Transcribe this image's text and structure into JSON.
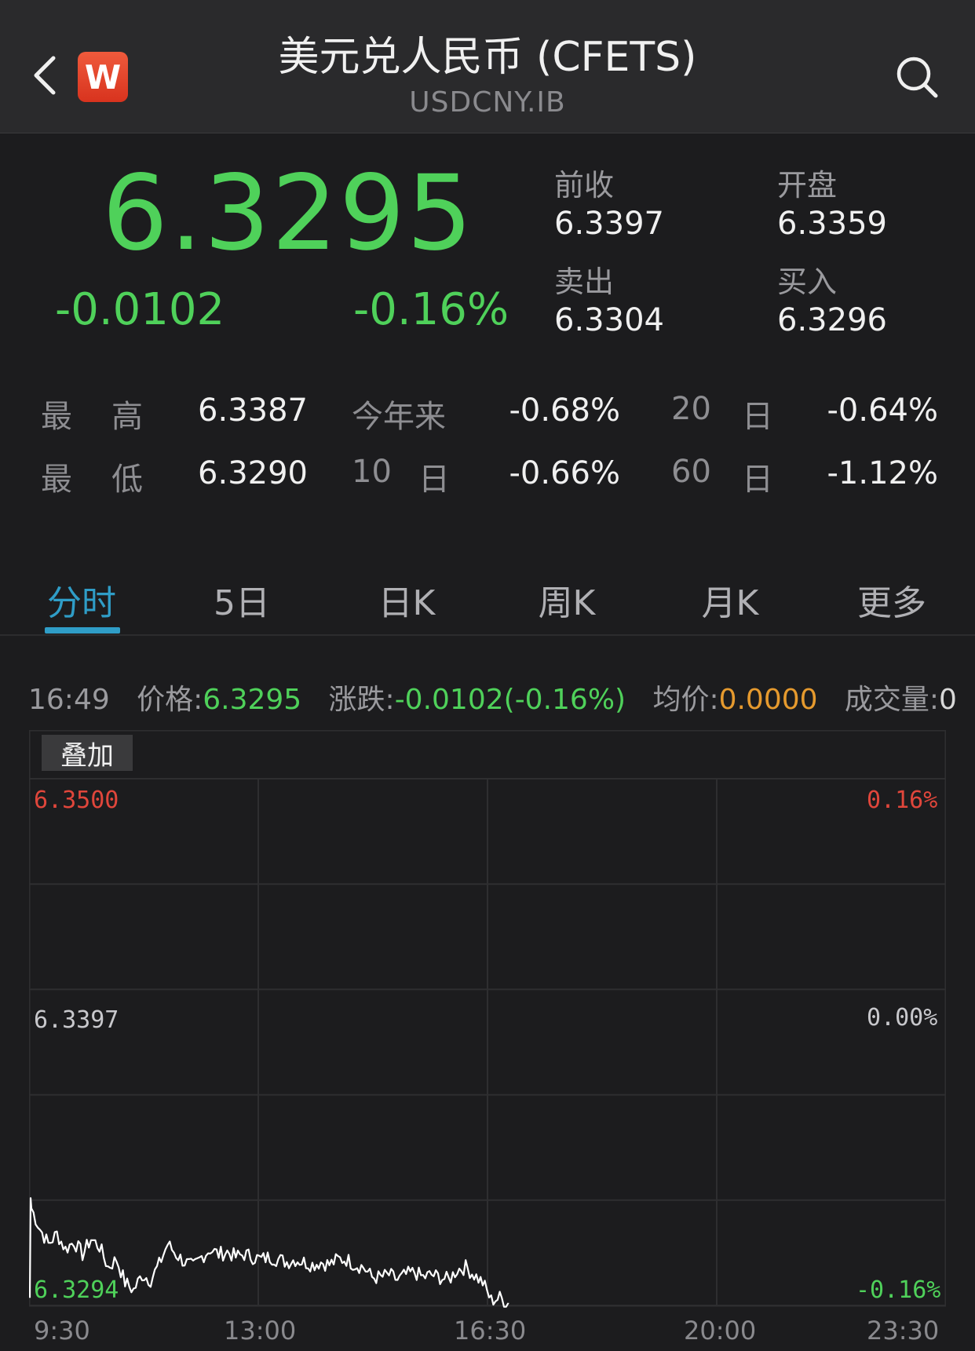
{
  "header": {
    "title": "美元兑人民币 (CFETS)",
    "symbol": "USDCNY.IB",
    "logo_letter": "W",
    "logo_color": "#e2432a"
  },
  "quote": {
    "price": "6.3295",
    "change": "-0.0102",
    "change_pct": "-0.16%",
    "prev_close_label": "前收",
    "prev_close": "6.3397",
    "open_label": "开盘",
    "open": "6.3359",
    "ask_label": "卖出",
    "ask": "6.3304",
    "bid_label": "买入",
    "bid": "6.3296"
  },
  "ranges": {
    "high_label_1": "最",
    "high_label_2": "高",
    "high": "6.3387",
    "low_label_1": "最",
    "low_label_2": "低",
    "low": "6.3290",
    "ytd_label": "今年来",
    "ytd": "-0.68%",
    "d10_num": "10",
    "d10_unit": "日",
    "d10": "-0.66%",
    "d20_num": "20",
    "d20_unit": "日",
    "d20": "-0.64%",
    "d60_num": "60",
    "d60_unit": "日",
    "d60": "-1.12%"
  },
  "tabs": [
    "分时",
    "5日",
    "日K",
    "周K",
    "月K",
    "更多"
  ],
  "active_tab": "分时",
  "info_line": {
    "time": "16:49",
    "price_label": "价格:",
    "price": "6.3295",
    "chg_label": "涨跌:",
    "chg": "-0.0102(-0.16%)",
    "avg_label": "均价:",
    "avg": "0.0000",
    "vol_label": "成交量:",
    "vol": "0"
  },
  "overlay_button": "叠加",
  "colors": {
    "up": "#e0463b",
    "down": "#4fd15a",
    "accent": "#2f9dc7",
    "avg": "#e69a2e"
  },
  "chart_data": {
    "type": "line",
    "y_labels_left": [
      "6.3500",
      "6.3397",
      "6.3294"
    ],
    "y_labels_right": [
      "0.16%",
      "0.00%",
      "-0.16%"
    ],
    "x_labels": [
      "9:30",
      "13:00",
      "16:30",
      "20:00",
      "23:30"
    ],
    "ylim": [
      6.3294,
      6.35
    ],
    "reference": 6.3397,
    "series": [
      {
        "values": [
          6.3332,
          6.3324,
          6.3318,
          6.3322,
          6.3316,
          6.3319,
          6.3314,
          6.332,
          6.3317,
          6.3309,
          6.3312,
          6.3303,
          6.33,
          6.3306,
          6.3304,
          6.331,
          6.3318,
          6.3314,
          6.3311,
          6.3309,
          6.3313,
          6.3316,
          6.3314,
          6.3315,
          6.3313,
          6.3314,
          6.3313,
          6.3312,
          6.3313,
          6.3312,
          6.3311,
          6.3312,
          6.3311,
          6.331,
          6.3311,
          6.331,
          6.3312,
          6.3312,
          6.331,
          6.3309,
          6.3305,
          6.3305,
          6.3306,
          6.3304,
          6.3306,
          6.3307,
          6.3305,
          6.3306,
          6.3305,
          6.3304,
          6.3308,
          6.3309,
          6.3306,
          6.3303,
          6.3296,
          6.3297,
          6.3295
        ]
      }
    ]
  }
}
